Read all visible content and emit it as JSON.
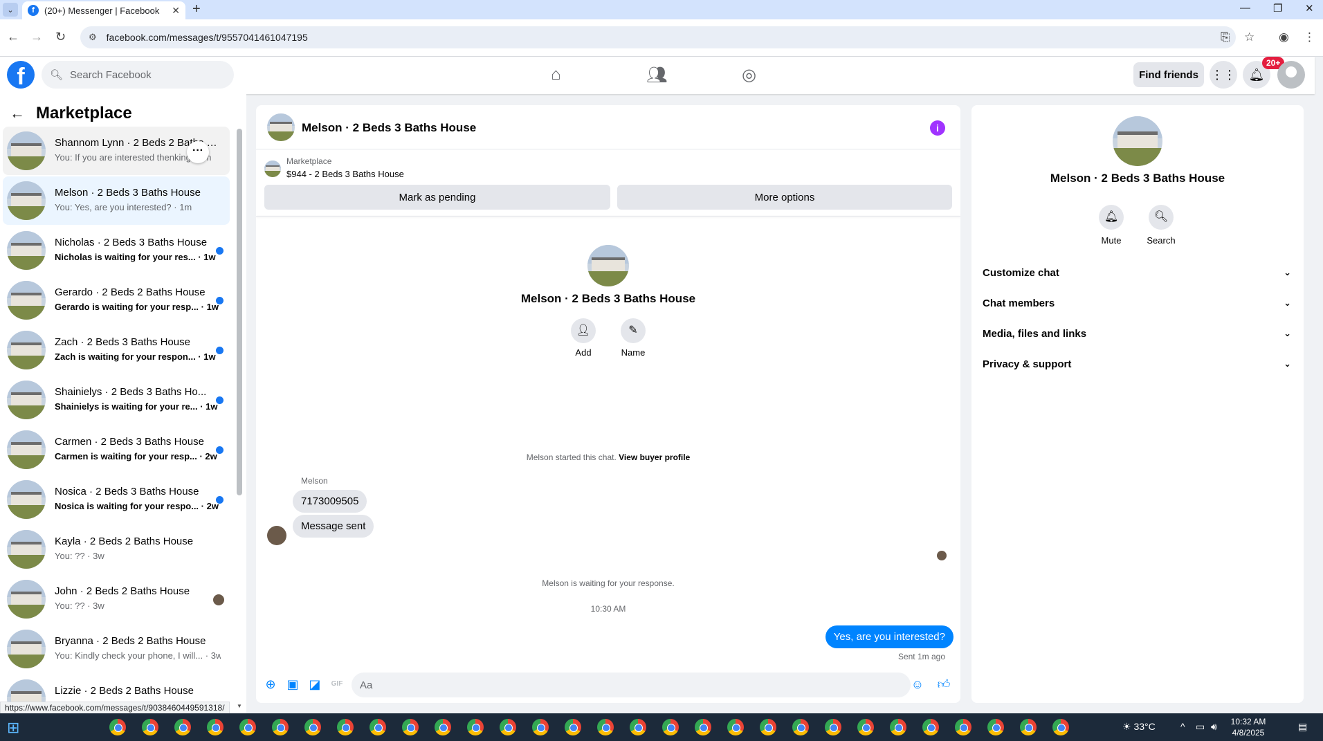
{
  "browser": {
    "tab_title": "(20+) Messenger | Facebook",
    "url": "facebook.com/messages/t/9557041461047195",
    "status_url": "https://www.facebook.com/messages/t/9038460449591318/"
  },
  "header": {
    "search_placeholder": "Search Facebook",
    "find_friends": "Find friends",
    "notification_badge": "20+"
  },
  "sidebar": {
    "title": "Marketplace",
    "conversations": [
      {
        "name": "Shannom Lynn · 2 Beds 2 Baths House",
        "snippet": "You: If you are interested thenking · 1m",
        "unread": false
      },
      {
        "name": "Melson · 2 Beds 3 Baths House",
        "snippet": "You: Yes, are you interested? · 1m",
        "unread": false
      },
      {
        "name": "Nicholas · 2 Beds 3 Baths House",
        "snippet": "Nicholas is waiting for your res... · 1w",
        "unread": true
      },
      {
        "name": "Gerardo · 2 Beds 2 Baths House",
        "snippet": "Gerardo is waiting for your resp... · 1w",
        "unread": true
      },
      {
        "name": "Zach · 2 Beds 3 Baths House",
        "snippet": "Zach is waiting for your respon... · 1w",
        "unread": true
      },
      {
        "name": "Shainielys · 2 Beds 3 Baths Ho...",
        "snippet": "Shainielys is waiting for your re... · 1w",
        "unread": true
      },
      {
        "name": "Carmen · 2 Beds 3 Baths House",
        "snippet": "Carmen is waiting for your resp... · 2w",
        "unread": true
      },
      {
        "name": "Nosica · 2 Beds 3 Baths House",
        "snippet": "Nosica is waiting for your respo... · 2w",
        "unread": true
      },
      {
        "name": "Kayla · 2 Beds 2 Baths House",
        "snippet": "You: ?? · 3w",
        "unread": false
      },
      {
        "name": "John · 2 Beds 2 Baths House",
        "snippet": "You: ?? · 3w",
        "unread": false
      },
      {
        "name": "Bryanna · 2 Beds 2 Baths House",
        "snippet": "You: Kindly check your phone, I will... · 3w",
        "unread": false
      },
      {
        "name": "Lizzie · 2 Beds 2 Baths House",
        "snippet": "",
        "unread": false
      }
    ]
  },
  "chat": {
    "title": "Melson · 2 Beds 3 Baths House",
    "marketplace_label": "Marketplace",
    "listing": "$944 - 2 Beds 3 Baths House",
    "mark_pending": "Mark as pending",
    "more_options": "More options",
    "profile_name": "Melson · 2 Beds 3 Baths House",
    "add_label": "Add",
    "name_label": "Name",
    "started_text": "Melson started this chat.",
    "view_buyer": "View buyer profile",
    "sender": "Melson",
    "msg1": "7173009505",
    "msg2": "Message sent",
    "waiting": "Melson is waiting for your response.",
    "time": "10:30 AM",
    "outgoing": "Yes, are you interested?",
    "sent_status": "Sent 1m ago",
    "composer_placeholder": "Aa"
  },
  "info_panel": {
    "name": "Melson · 2 Beds 3 Baths House",
    "mute": "Mute",
    "search": "Search",
    "sections": [
      "Customize chat",
      "Chat members",
      "Media, files and links",
      "Privacy & support"
    ]
  },
  "taskbar": {
    "temperature": "33°C",
    "time": "10:32 AM",
    "date": "4/8/2025"
  }
}
